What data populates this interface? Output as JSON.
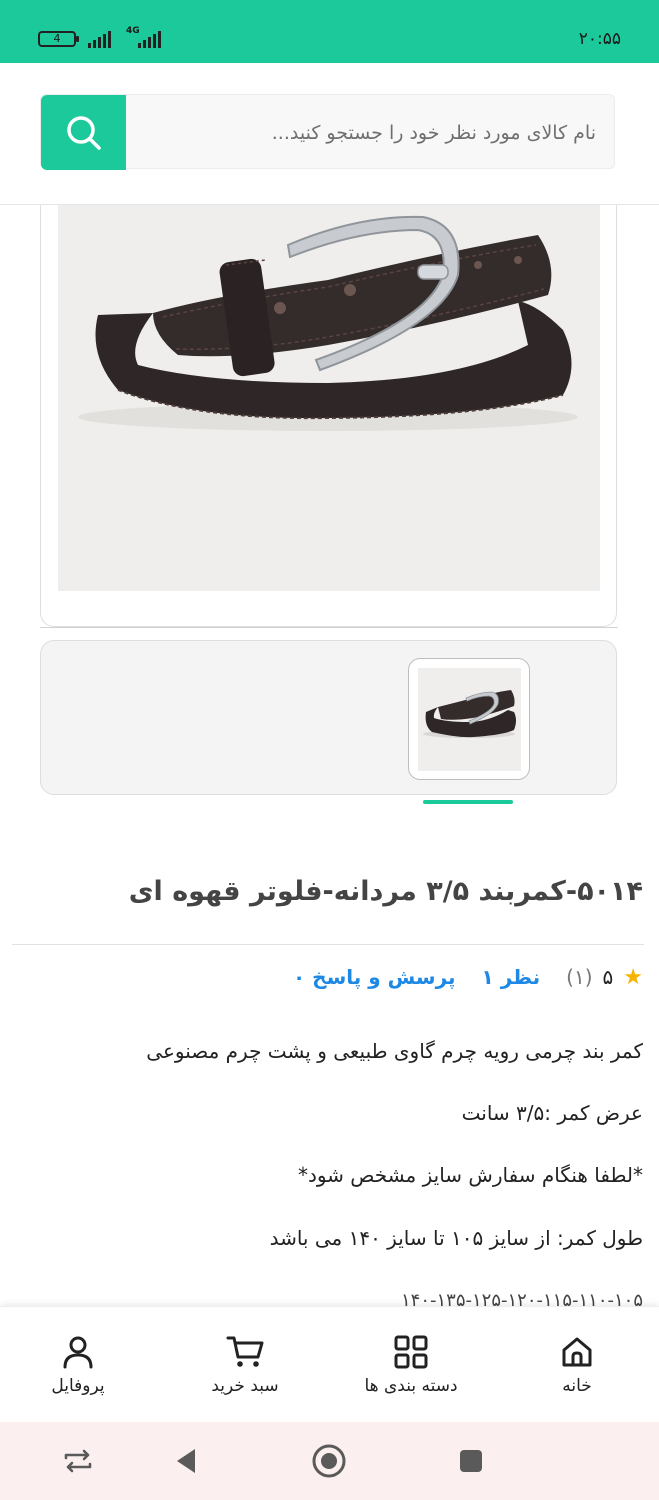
{
  "status_bar": {
    "time": "۲۰:۵۵",
    "battery": "4",
    "network": "4G"
  },
  "search": {
    "placeholder": "نام کالای مورد نظر خود را جستجو کنید..."
  },
  "product": {
    "title": "۵۰۱۴-کمربند ۳/۵ مردانه-فلوتر قهوه ای",
    "rating": "۵",
    "rating_count": "(۱)",
    "reviews_link": "نظر ۱",
    "qa_link": "پرسش و پاسخ ۰"
  },
  "description": {
    "line1": "کمر بند چرمی رویه چرم گاوی طبیعی و  پشت چرم مصنوعی",
    "line2": "عرض کمر :۳/۵ سانت",
    "line3": "*لطفا هنگام سفارش سایز مشخص شود*",
    "line4": "طول کمر: از سایز  ۱۰۵ تا سایز ۱۴۰ می باشد",
    "line5": "۱۴۰-۱۳۵-۱۲۵-۱۲۰-۱۱۵-۱۱۰-۱۰۵"
  },
  "bottom_nav": {
    "home": "خانه",
    "categories": "دسته بندی ها",
    "cart": "سبد خرید",
    "profile": "پروفایل"
  },
  "colors": {
    "accent": "#1cc99a",
    "link": "#1e88e5",
    "star": "#f6b400"
  },
  "icons": [
    "search-icon",
    "home-icon",
    "grid-icon",
    "cart-icon",
    "user-icon",
    "back-icon",
    "home-circle-icon",
    "recents-icon",
    "rotate-icon"
  ]
}
